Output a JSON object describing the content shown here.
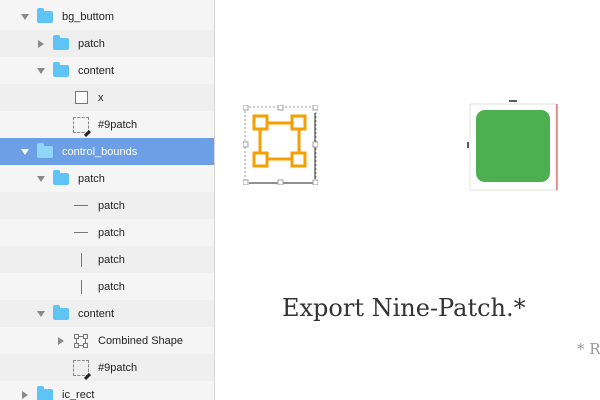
{
  "layers": [
    {
      "label": "bg_buttom",
      "indent": 1,
      "toggle": "down",
      "icon": "folder-icon",
      "selected": false
    },
    {
      "label": "patch",
      "indent": 2,
      "toggle": "right",
      "icon": "folder-icon",
      "selected": false
    },
    {
      "label": "content",
      "indent": 2,
      "toggle": "down",
      "icon": "folder-icon",
      "selected": false
    },
    {
      "label": "x",
      "indent": 3,
      "toggle": "none",
      "icon": "rectangle-icon",
      "selected": false
    },
    {
      "label": "#9patch",
      "indent": 3,
      "toggle": "none",
      "icon": "slice-icon",
      "selected": false
    },
    {
      "label": "control_bounds",
      "indent": 1,
      "toggle": "down",
      "icon": "folder-icon",
      "selected": true
    },
    {
      "label": "patch",
      "indent": 2,
      "toggle": "down",
      "icon": "folder-icon",
      "selected": false
    },
    {
      "label": "patch",
      "indent": 3,
      "toggle": "none",
      "icon": "horizontal-line-icon",
      "selected": false
    },
    {
      "label": "patch",
      "indent": 3,
      "toggle": "none",
      "icon": "horizontal-line-icon",
      "selected": false
    },
    {
      "label": "patch",
      "indent": 3,
      "toggle": "none",
      "icon": "vertical-line-icon",
      "selected": false
    },
    {
      "label": "patch",
      "indent": 3,
      "toggle": "none",
      "icon": "vertical-line-icon",
      "selected": false
    },
    {
      "label": "content",
      "indent": 2,
      "toggle": "down",
      "icon": "folder-icon",
      "selected": false
    },
    {
      "label": "Combined Shape",
      "indent": 3,
      "toggle": "right",
      "icon": "combined-shape-icon",
      "selected": false
    },
    {
      "label": "#9patch",
      "indent": 3,
      "toggle": "none",
      "icon": "slice-icon",
      "selected": false
    },
    {
      "label": "ic_rect",
      "indent": 1,
      "toggle": "right",
      "icon": "folder-icon",
      "selected": false
    }
  ],
  "canvas": {
    "title": "Export Nine-Patch.*",
    "footnote": "* R"
  },
  "colors": {
    "selection": "#6d9fe6",
    "folder": "#5ec4f5",
    "orange_icon": "#f5a000",
    "green_fill": "#4caf50",
    "red_guide": "#e53935"
  }
}
